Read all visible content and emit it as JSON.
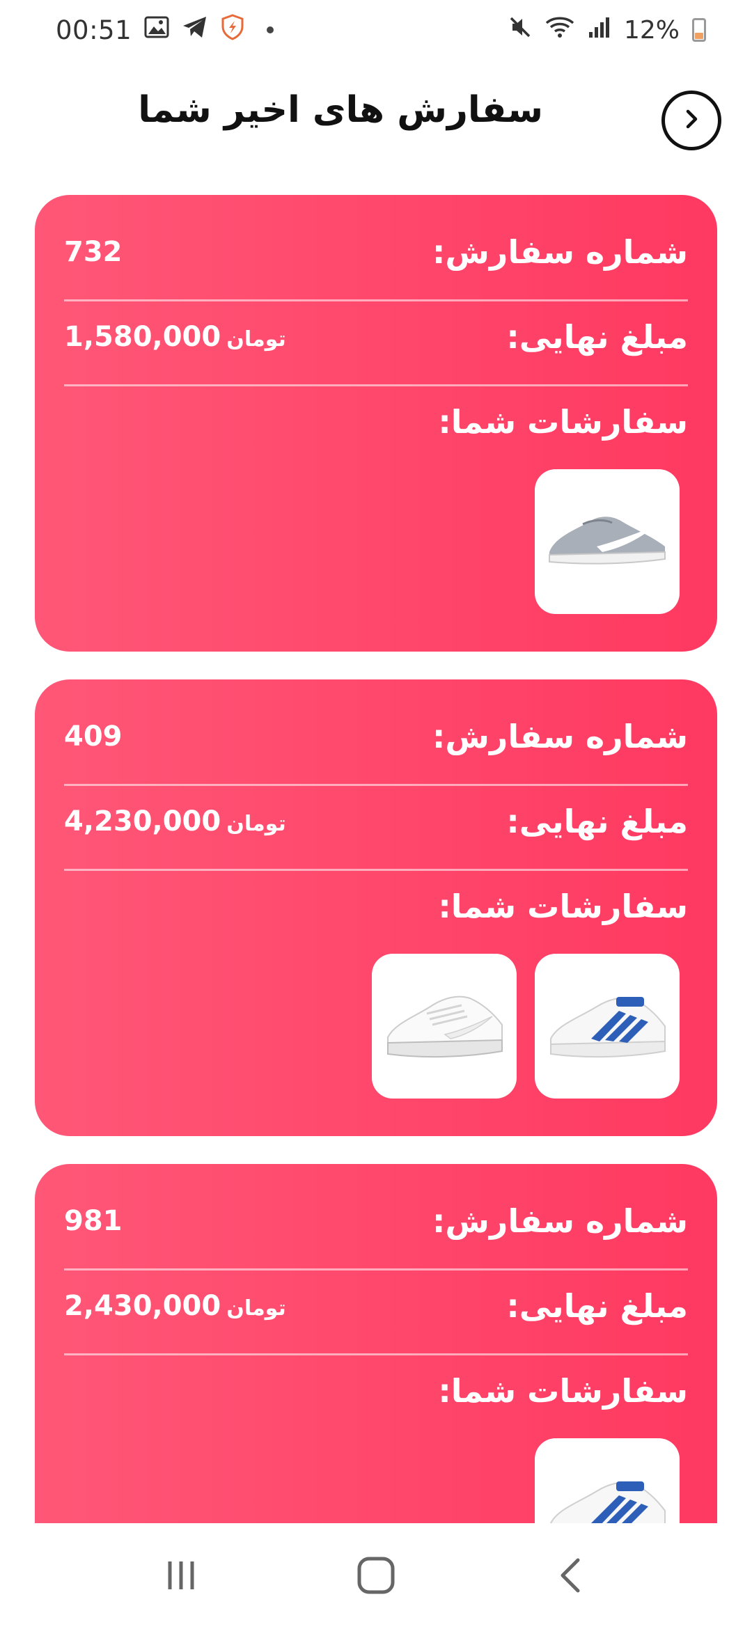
{
  "status_bar": {
    "time": "00:51",
    "battery": "12%",
    "icons": [
      "gallery-icon",
      "telegram-icon",
      "shield-app-icon",
      "notification-dot",
      "mute-icon",
      "wifi-icon",
      "signal-icon",
      "battery-icon"
    ]
  },
  "header": {
    "title": "سفارش های اخیر شما",
    "back_icon": "chevron-right-circle-icon"
  },
  "labels": {
    "order_number": "شماره سفارش:",
    "final_amount": "مبلغ نهایی:",
    "your_orders": "سفارشات شما:",
    "currency": "تومان"
  },
  "orders": [
    {
      "number": "732",
      "amount": "1,580,000",
      "items": [
        "grey-sneaker-image"
      ]
    },
    {
      "number": "409",
      "amount": "4,230,000",
      "items": [
        "blue-white-adidas-sneaker-image",
        "white-sneaker-image"
      ]
    },
    {
      "number": "981",
      "amount": "2,430,000",
      "items": [
        "blue-white-adidas-sneaker-image"
      ]
    }
  ],
  "colors": {
    "card_start": "#ff5777",
    "card_end": "#ff3961",
    "text_on_card": "#ffffff",
    "title": "#111111"
  },
  "nav_bar": {
    "icons": [
      "recent-apps-icon",
      "home-icon",
      "back-icon"
    ]
  }
}
